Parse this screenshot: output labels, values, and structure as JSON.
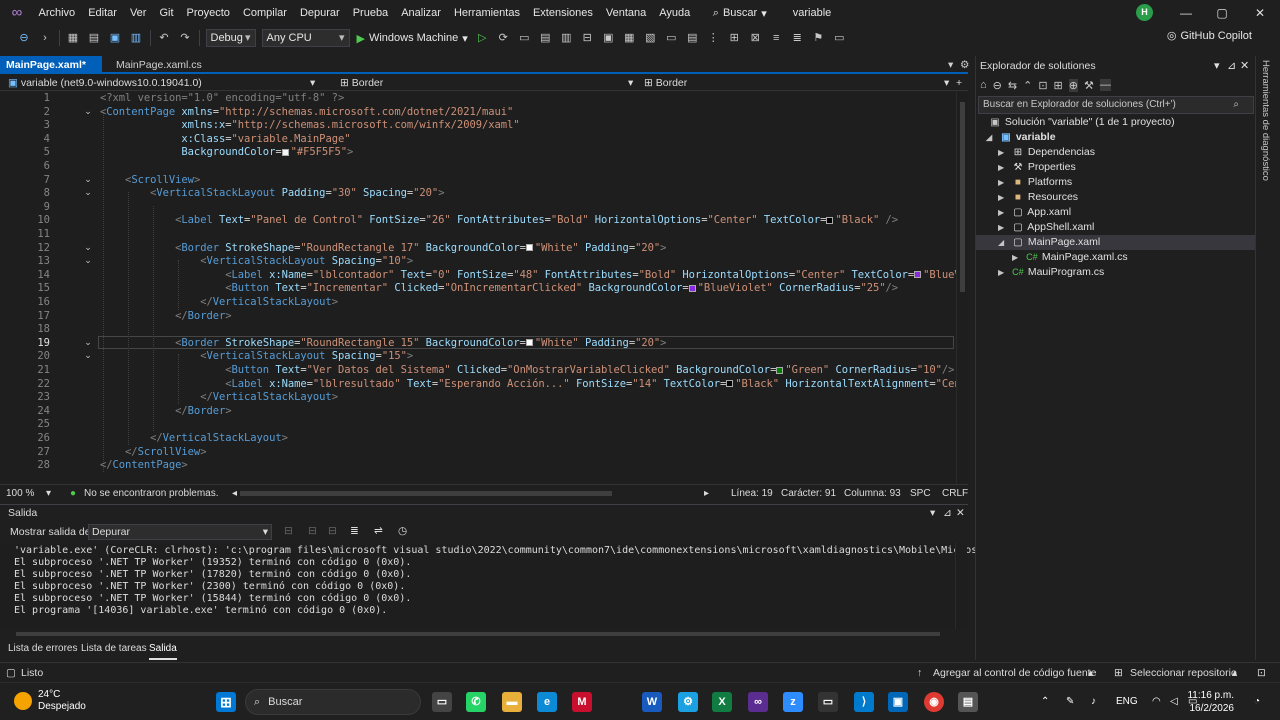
{
  "menu": {
    "items": [
      "Archivo",
      "Editar",
      "Ver",
      "Git",
      "Proyecto",
      "Compilar",
      "Depurar",
      "Prueba",
      "Analizar",
      "Herramientas",
      "Extensiones",
      "Ventana",
      "Ayuda"
    ],
    "search_label": "Buscar",
    "solution_name": "variable",
    "avatar_initials": "H"
  },
  "toolbar": {
    "config": "Debug",
    "platform": "Any CPU",
    "run_target": "Windows Machine",
    "copilot": "GitHub Copilot"
  },
  "tabs": [
    {
      "label": "MainPage.xaml*",
      "active": true
    },
    {
      "label": "MainPage.xaml.cs",
      "active": false
    }
  ],
  "navbar": {
    "project": "variable (net9.0-windows10.0.19041.0)",
    "element1": "Border",
    "element2": "Border"
  },
  "editor": {
    "current_line": 19,
    "lines": [
      {
        "n": 1,
        "html": "<span class='p'>&lt;?xml version=\"1.0\" encoding=\"utf-8\" ?&gt;</span>"
      },
      {
        "n": 2,
        "html": "<span class='p'>&lt;</span><span class='t'>ContentPage</span> <span class='a'>xmlns</span><span class='e'>=</span><span class='v'>\"http://schemas.microsoft.com/dotnet/2021/maui\"</span>"
      },
      {
        "n": 3,
        "html": "             <span class='a'>xmlns:x</span><span class='e'>=</span><span class='v'>\"http://schemas.microsoft.com/winfx/2009/xaml\"</span>"
      },
      {
        "n": 4,
        "html": "             <span class='a'>x:Class</span><span class='e'>=</span><span class='v'>\"variable.MainPage\"</span>"
      },
      {
        "n": 5,
        "html": "             <span class='a'>BackgroundColor</span><span class='e'>=</span><span class='sw' style='background:#f5f5f5'></span><span class='v'>\"#F5F5F5\"</span><span class='p'>&gt;</span>"
      },
      {
        "n": 6,
        "html": ""
      },
      {
        "n": 7,
        "html": "    <span class='p'>&lt;</span><span class='t'>ScrollView</span><span class='p'>&gt;</span>"
      },
      {
        "n": 8,
        "html": "        <span class='p'>&lt;</span><span class='t'>VerticalStackLayout</span> <span class='a'>Padding</span><span class='e'>=</span><span class='v'>\"30\"</span> <span class='a'>Spacing</span><span class='e'>=</span><span class='v'>\"20\"</span><span class='p'>&gt;</span>"
      },
      {
        "n": 9,
        "html": ""
      },
      {
        "n": 10,
        "html": "            <span class='p'>&lt;</span><span class='t'>Label</span> <span class='a'>Text</span><span class='e'>=</span><span class='v'>\"Panel de Control\"</span> <span class='a'>FontSize</span><span class='e'>=</span><span class='v'>\"26\"</span> <span class='a'>FontAttributes</span><span class='e'>=</span><span class='v'>\"Bold\"</span> <span class='a'>HorizontalOptions</span><span class='e'>=</span><span class='v'>\"Center\"</span> <span class='a'>TextColor</span><span class='e'>=</span><span class='sw' style='background:#000'></span><span class='v'>\"Black\"</span> <span class='p'>/&gt;</span>"
      },
      {
        "n": 11,
        "html": ""
      },
      {
        "n": 12,
        "html": "            <span class='p'>&lt;</span><span class='t'>Border</span> <span class='a'>StrokeShape</span><span class='e'>=</span><span class='v'>\"RoundRectangle 17\"</span> <span class='a'>BackgroundColor</span><span class='e'>=</span><span class='sw' style='background:#fff'></span><span class='v'>\"White\"</span> <span class='a'>Padding</span><span class='e'>=</span><span class='v'>\"20\"</span><span class='p'>&gt;</span>"
      },
      {
        "n": 13,
        "html": "                <span class='p'>&lt;</span><span class='t'>VerticalStackLayout</span> <span class='a'>Spacing</span><span class='e'>=</span><span class='v'>\"10\"</span><span class='p'>&gt;</span>"
      },
      {
        "n": 14,
        "html": "                    <span class='p'>&lt;</span><span class='t'>Label</span> <span class='a'>x:Name</span><span class='e'>=</span><span class='v'>\"lblcontador\"</span> <span class='a'>Text</span><span class='e'>=</span><span class='v'>\"0\"</span> <span class='a'>FontSize</span><span class='e'>=</span><span class='v'>\"48\"</span> <span class='a'>FontAttributes</span><span class='e'>=</span><span class='v'>\"Bold\"</span> <span class='a'>HorizontalOptions</span><span class='e'>=</span><span class='v'>\"Center\"</span> <span class='a'>TextColor</span><span class='e'>=</span><span class='sw' style='background:#8a2be2'></span><span class='v'>\"BlueVio</span>"
      },
      {
        "n": 15,
        "html": "                    <span class='p'>&lt;</span><span class='t'>Button</span> <span class='a'>Text</span><span class='e'>=</span><span class='v'>\"Incrementar\"</span> <span class='a'>Clicked</span><span class='e'>=</span><span class='v'>\"OnIncrementarClicked\"</span> <span class='a'>BackgroundColor</span><span class='e'>=</span><span class='sw' style='background:#8a2be2'></span><span class='v'>\"BlueViolet\"</span> <span class='a'>CornerRadius</span><span class='e'>=</span><span class='v'>\"25\"</span><span class='p'>/&gt;</span>"
      },
      {
        "n": 16,
        "html": "                <span class='p'>&lt;/</span><span class='t'>VerticalStackLayout</span><span class='p'>&gt;</span>"
      },
      {
        "n": 17,
        "html": "            <span class='p'>&lt;/</span><span class='t'>Border</span><span class='p'>&gt;</span>"
      },
      {
        "n": 18,
        "html": ""
      },
      {
        "n": 19,
        "html": "            <span class='p'>&lt;</span><span class='t'>Border</span> <span class='a'>StrokeShape</span><span class='e'>=</span><span class='v'>\"RoundRectangle 15\"</span> <span class='a'>BackgroundColor</span><span class='e'>=</span><span class='sw' style='background:#fff'></span><span class='v'>\"White\"</span> <span class='a'>Padding</span><span class='e'>=</span><span class='v'>\"20\"</span><span class='p'>&gt;</span>"
      },
      {
        "n": 20,
        "html": "                <span class='p'>&lt;</span><span class='t'>VerticalStackLayout</span> <span class='a'>Spacing</span><span class='e'>=</span><span class='v'>\"15\"</span><span class='p'>&gt;</span>"
      },
      {
        "n": 21,
        "html": "                    <span class='p'>&lt;</span><span class='t'>Button</span> <span class='a'>Text</span><span class='e'>=</span><span class='v'>\"Ver Datos del Sistema\"</span> <span class='a'>Clicked</span><span class='e'>=</span><span class='v'>\"OnMostrarVariableClicked\"</span> <span class='a'>BackgroundColor</span><span class='e'>=</span><span class='sw' style='background:#008000'></span><span class='v'>\"Green\"</span> <span class='a'>CornerRadius</span><span class='e'>=</span><span class='v'>\"10\"</span><span class='p'>/&gt;</span>"
      },
      {
        "n": 22,
        "html": "                    <span class='p'>&lt;</span><span class='t'>Label</span> <span class='a'>x:Name</span><span class='e'>=</span><span class='v'>\"lblresultado\"</span> <span class='a'>Text</span><span class='e'>=</span><span class='v'>\"Esperando Acción...\"</span> <span class='a'>FontSize</span><span class='e'>=</span><span class='v'>\"14\"</span> <span class='a'>TextColor</span><span class='e'>=</span><span class='sw' style='background:#000'></span><span class='v'>\"Black\"</span> <span class='a'>HorizontalTextAlignment</span><span class='e'>=</span><span class='v'>\"Center</span>"
      },
      {
        "n": 23,
        "html": "                <span class='p'>&lt;/</span><span class='t'>VerticalStackLayout</span><span class='p'>&gt;</span>"
      },
      {
        "n": 24,
        "html": "            <span class='p'>&lt;/</span><span class='t'>Border</span><span class='p'>&gt;</span>"
      },
      {
        "n": 25,
        "html": ""
      },
      {
        "n": 26,
        "html": "        <span class='p'>&lt;/</span><span class='t'>VerticalStackLayout</span><span class='p'>&gt;</span>"
      },
      {
        "n": 27,
        "html": "    <span class='p'>&lt;/</span><span class='t'>ScrollView</span><span class='p'>&gt;</span>"
      },
      {
        "n": 28,
        "html": "<span class='p'>&lt;/</span><span class='t'>ContentPage</span><span class='p'>&gt;</span>"
      }
    ]
  },
  "editor_status": {
    "zoom": "100 %",
    "problems": "No se encontraron problemas.",
    "line": "Línea: 19",
    "char": "Carácter: 91",
    "column": "Columna: 93",
    "indent": "SPC",
    "eol": "CRLF"
  },
  "output": {
    "title": "Salida",
    "show_from_label": "Mostrar salida de:",
    "source": "Depurar",
    "lines": [
      "'variable.exe' (CoreCLR: clrhost): 'c:\\program files\\microsoft visual studio\\2022\\community\\common7\\ide\\commonextensions\\microsoft\\xamldiagnostics\\Mobile\\Microsoft.Visu",
      "El subproceso '.NET TP Worker' (19352) terminó con código 0 (0x0).",
      "El subproceso '.NET TP Worker' (17820) terminó con código 0 (0x0).",
      "El subproceso '.NET TP Worker' (2300) terminó con código 0 (0x0).",
      "El subproceso '.NET TP Worker' (15844) terminó con código 0 (0x0).",
      "El programa '[14036] variable.exe' terminó con código 0 (0x0)."
    ]
  },
  "bottom_tabs": [
    "Lista de errores",
    "Lista de tareas",
    "Salida"
  ],
  "solution_explorer": {
    "title": "Explorador de solutiones",
    "search_placeholder": "Buscar en Explorador de soluciones (Ctrl+')",
    "solution_label": "Solución \"variable\" (1 de 1 proyecto)",
    "items": [
      "variable",
      "Dependencias",
      "Properties",
      "Platforms",
      "Resources",
      "App.xaml",
      "AppShell.xaml",
      "MainPage.xaml",
      "MainPage.xaml.cs",
      "MauiProgram.cs"
    ]
  },
  "right_rail": "Herramientas de diagnóstico",
  "status": {
    "ready": "Listo",
    "add_source_control": "Agregar al control de código fuente",
    "select_repo": "Seleccionar repositorio"
  },
  "taskbar": {
    "temp": "24°C",
    "weather": "Despejado",
    "search": "Buscar",
    "lang": "ENG",
    "time": "11:16 p.m.",
    "date": "16/2/2026"
  }
}
